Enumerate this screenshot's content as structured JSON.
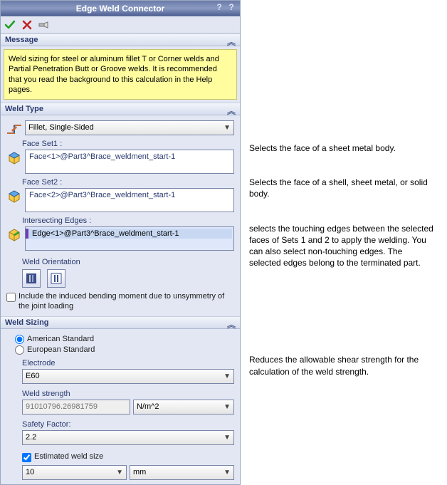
{
  "title": "Edge Weld Connector",
  "help1": "?",
  "help2": "?",
  "sections": {
    "message": {
      "title": "Message",
      "body": "Weld sizing for steel or aluminum fillet T or Corner welds and Partial Penetration Butt or Groove welds. It is recommended that you read the background to this calculation in the Help pages."
    },
    "weldType": {
      "title": "Weld Type",
      "type_selected": "Fillet, Single-Sided",
      "faceSet1_label": "Face Set1 :",
      "faceSet1_item": "Face<1>@Part3^Brace_weldment_start-1",
      "faceSet2_label": "Face Set2 :",
      "faceSet2_item": "Face<2>@Part3^Brace_weldment_start-1",
      "intersect_label": "Intersecting Edges :",
      "intersect_item": "Edge<1>@Part3^Brace_weldment_start-1",
      "orient_label": "Weld Orientation",
      "bending_check": "Include the induced bending moment due to unsymmetry of the joint loading"
    },
    "weldSizing": {
      "title": "Weld Sizing",
      "radio_american": "American Standard",
      "radio_european": "European Standard",
      "electrode_label": "Electrode",
      "electrode_value": "E60",
      "strength_label": "Weld strength",
      "strength_value": "91010796.26981759",
      "strength_unit": "N/m^2",
      "safety_label": "Safety Factor:",
      "safety_value": "2.2",
      "est_check": "Estimated weld size",
      "est_value": "10",
      "est_unit": "mm"
    }
  },
  "annotations": {
    "a1": "Selects the face of a  sheet metal body.",
    "a2": "Selects the face of a shell, sheet metal, or solid body.",
    "a3": "selects the touching edges between the selected faces of Sets 1 and 2 to apply the welding. You can also select non-touching edges. The selected edges belong to the terminated part.",
    "a4": "Reduces the allowable shear strength for the calculation of the weld strength."
  }
}
